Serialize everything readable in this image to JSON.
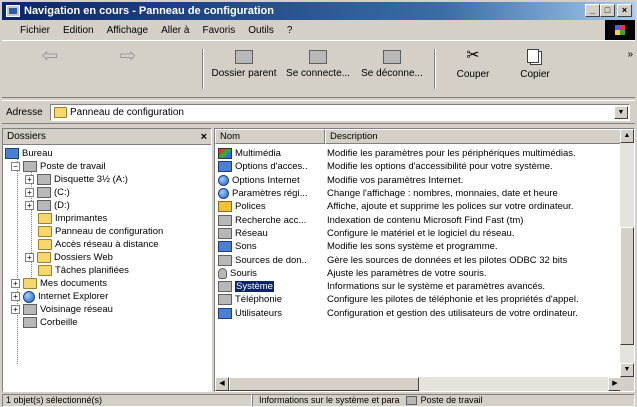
{
  "window": {
    "title": "Navigation en cours - Panneau de configuration",
    "controls": {
      "minimize": "_",
      "maximize": "□",
      "close": "×"
    }
  },
  "menu": [
    "Fichier",
    "Edition",
    "Affichage",
    "Aller à",
    "Favoris",
    "Outils",
    "?"
  ],
  "toolbar": {
    "back": "Précédente",
    "forward": "Suivante",
    "up": "Dossier parent",
    "connect": "Se connecte...",
    "disconnect": "Se déconne...",
    "cut": "Couper",
    "copy": "Copier",
    "more": "»"
  },
  "address": {
    "label": "Adresse",
    "value": "Panneau de configuration"
  },
  "folders": {
    "title": "Dossiers",
    "close": "×",
    "tree": [
      {
        "label": "Bureau",
        "icon": "desktop-icon"
      },
      {
        "label": "Poste de travail",
        "icon": "computer-icon"
      },
      {
        "label": "Disquette 3½ (A:)",
        "icon": "floppy-icon"
      },
      {
        "label": "(C:)",
        "icon": "drive-icon"
      },
      {
        "label": "(D:)",
        "icon": "cdrom-icon"
      },
      {
        "label": "Imprimantes",
        "icon": "folder-icon"
      },
      {
        "label": "Panneau de configuration",
        "icon": "folder-icon"
      },
      {
        "label": "Accès réseau à distance",
        "icon": "folder-icon"
      },
      {
        "label": "Dossiers Web",
        "icon": "folder-icon"
      },
      {
        "label": "Tâches planifiées",
        "icon": "folder-icon"
      },
      {
        "label": "Mes documents",
        "icon": "folder-icon"
      },
      {
        "label": "Internet Explorer",
        "icon": "ie-icon"
      },
      {
        "label": "Voisinage réseau",
        "icon": "network-icon"
      },
      {
        "label": "Corbeille",
        "icon": "recycle-icon"
      }
    ]
  },
  "list": {
    "columns": [
      "Nom",
      "Description"
    ],
    "rows": [
      {
        "name": "Multimédia",
        "description": "Modifie les paramètres pour les périphériques multimédias."
      },
      {
        "name": "Options d'acces...",
        "description": "Modifie les options d'accessibilité pour votre système."
      },
      {
        "name": "Options Internet",
        "description": "Modifie vos paramètres Internet."
      },
      {
        "name": "Paramètres régi...",
        "description": "Change l'affichage : nombres, monnaies, date et heure"
      },
      {
        "name": "Polices",
        "description": "Affiche, ajoute et supprime les polices sur votre ordinateur."
      },
      {
        "name": "Recherche acc...",
        "description": "Indexation de contenu Microsoft Find Fast (tm)"
      },
      {
        "name": "Réseau",
        "description": "Configure le matériel et le logiciel du réseau."
      },
      {
        "name": "Sons",
        "description": "Modifie les sons système et programme."
      },
      {
        "name": "Sources de don...",
        "description": "Gère les sources de données et les pilotes ODBC 32 bits"
      },
      {
        "name": "Souris",
        "description": "Ajuste les paramètres de votre souris."
      },
      {
        "name": "Système",
        "description": "Informations sur le système et paramètres avancés."
      },
      {
        "name": "Téléphonie",
        "description": "Configure les pilotes de téléphonie et les propriétés d'appel."
      },
      {
        "name": "Utilisateurs",
        "description": "Configuration et gestion des utilisateurs de votre ordinateur."
      }
    ],
    "selected": "Système"
  },
  "status": {
    "left": "1 objet(s) sélectionné(s)",
    "middle": "Informations sur le système et para",
    "zone": "Poste de travail"
  }
}
